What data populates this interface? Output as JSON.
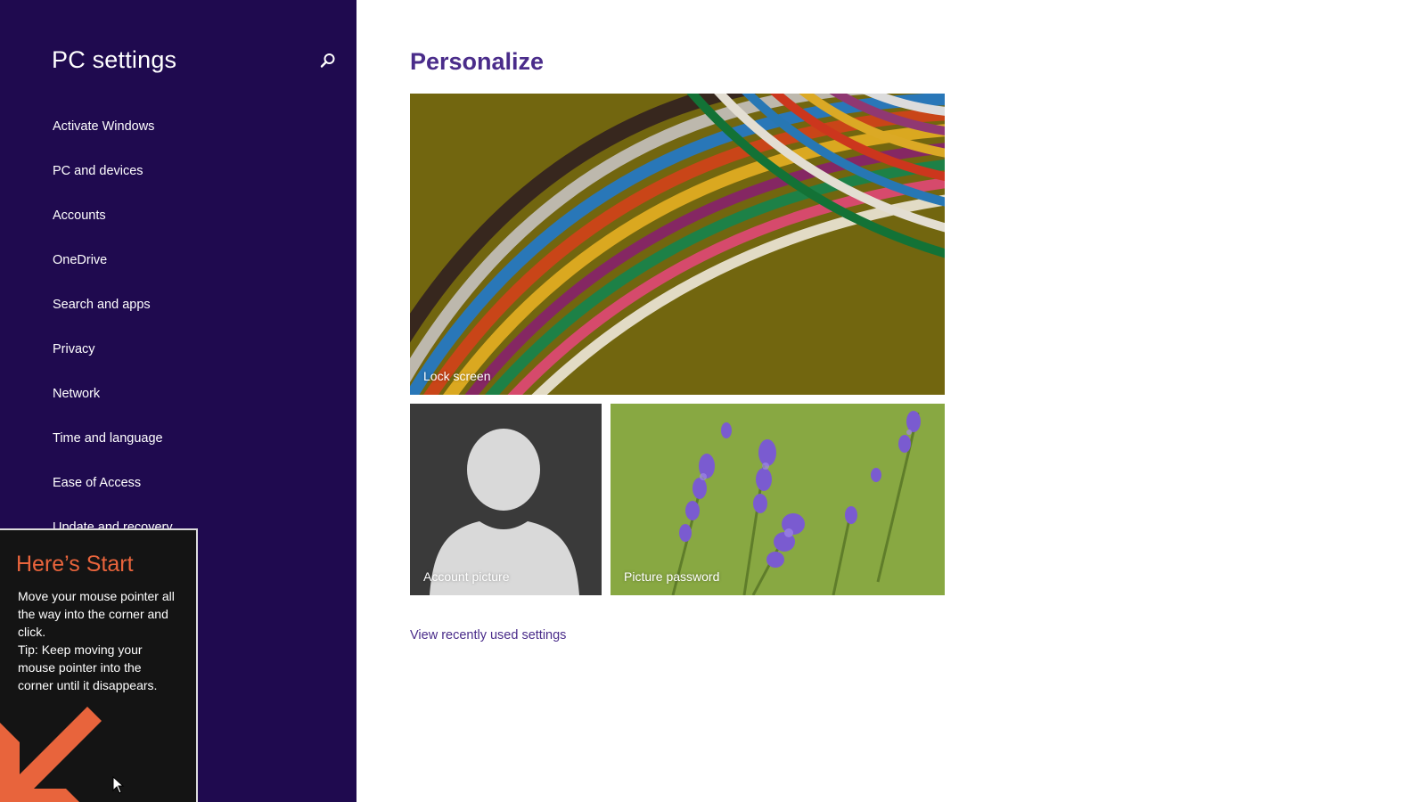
{
  "sidebar": {
    "title": "PC settings",
    "search_icon": "search-icon",
    "items": [
      {
        "label": "Activate Windows"
      },
      {
        "label": "PC and devices"
      },
      {
        "label": "Accounts"
      },
      {
        "label": "OneDrive"
      },
      {
        "label": "Search and apps"
      },
      {
        "label": "Privacy"
      },
      {
        "label": "Network"
      },
      {
        "label": "Time and language"
      },
      {
        "label": "Ease of Access"
      },
      {
        "label": "Update and recovery"
      }
    ],
    "background_color": "#1f0a4f"
  },
  "start_tip": {
    "title": "Here’s Start",
    "body_line1": "Move your mouse pointer all the way into the corner and click.",
    "body_line2": "Tip: Keep moving your mouse pointer into the corner until it disappears.",
    "accent_color": "#e8643c",
    "arrow_icon": "arrow-down-left-icon",
    "cursor_icon": "mouse-pointer-icon"
  },
  "main": {
    "title": "Personalize",
    "title_color": "#4a2c8a",
    "tiles": [
      {
        "label": "Lock screen"
      },
      {
        "label": "Account picture"
      },
      {
        "label": "Picture password"
      }
    ],
    "recent_link": "View recently used settings"
  }
}
